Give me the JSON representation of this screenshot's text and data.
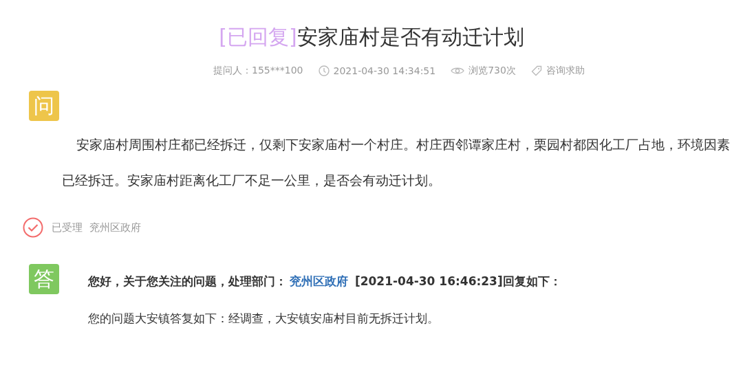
{
  "title": {
    "status": "[已回复]",
    "text": "安家庙村是否有动迁计划"
  },
  "meta": [
    {
      "kind": "asker",
      "text": "提问人：155***100"
    },
    {
      "kind": "time",
      "text": "2021-04-30 14:34:51"
    },
    {
      "kind": "views",
      "text": "浏览730次"
    },
    {
      "kind": "category",
      "text": "咨询求助"
    }
  ],
  "question": {
    "badge": "问",
    "text": "安家庙村周围村庄都已经拆迁，仅剩下安家庙村一个村庄。村庄西邻谭家庄村，栗园村都因化工厂占地，环境因素已经拆迁。安家庙村距离化工厂不足一公里，是否会有动迁计划。"
  },
  "status": {
    "state": "已受理",
    "department": "兖州区政府"
  },
  "answer": {
    "badge": "答",
    "header_before": "您好，关于您关注的问题，处理部门：",
    "department_link": "兖州区政府",
    "header_after": " [2021-04-30 16:46:23]回复如下：",
    "text": "您的问题大安镇答复如下：经调查，大安镇安庙村目前无拆迁计划。"
  }
}
